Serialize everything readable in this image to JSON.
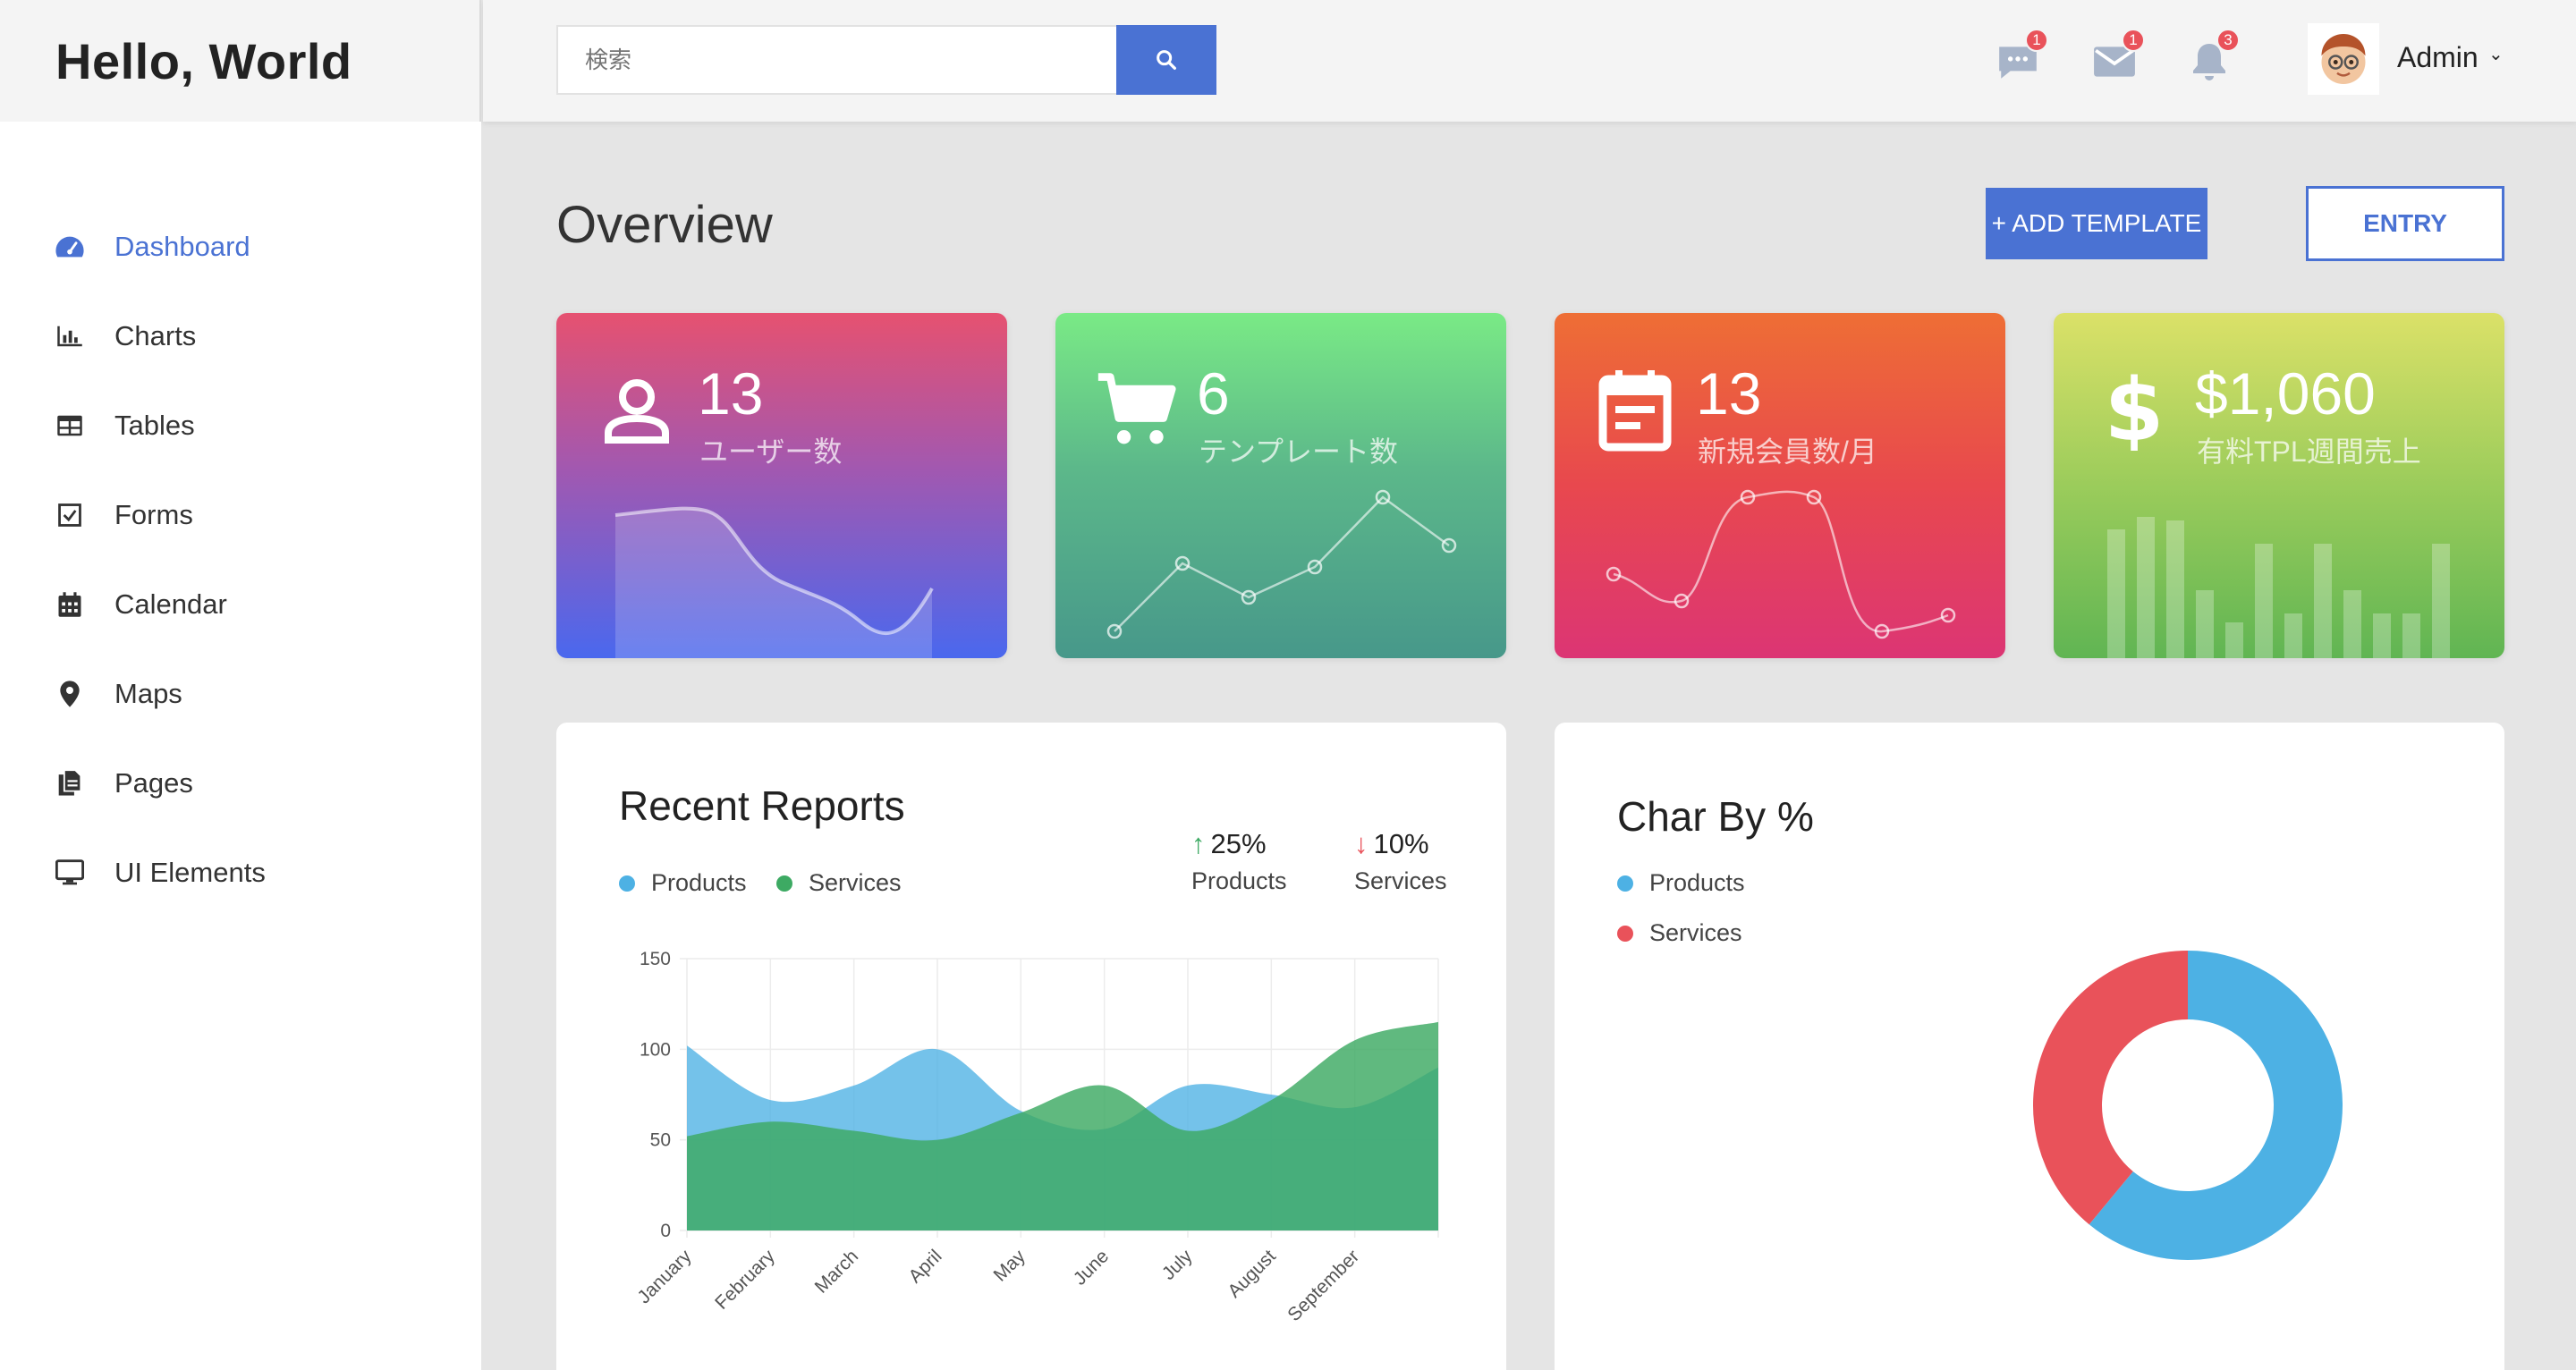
{
  "app": {
    "title": "Hello, World"
  },
  "search": {
    "placeholder": "検索"
  },
  "topbar": {
    "messages_badge": "1",
    "mail_badge": "1",
    "notifications_badge": "3",
    "user_name": "Admin"
  },
  "sidebar": {
    "items": [
      {
        "label": "Dashboard",
        "icon": "dashboard-icon",
        "active": true
      },
      {
        "label": "Charts",
        "icon": "bar-chart-icon"
      },
      {
        "label": "Tables",
        "icon": "table-icon"
      },
      {
        "label": "Forms",
        "icon": "checkbox-icon"
      },
      {
        "label": "Calendar",
        "icon": "calendar-icon"
      },
      {
        "label": "Maps",
        "icon": "map-pin-icon"
      },
      {
        "label": "Pages",
        "icon": "pages-icon"
      },
      {
        "label": "UI Elements",
        "icon": "monitor-icon"
      }
    ]
  },
  "main": {
    "title": "Overview",
    "add_button": "+ ADD TEMPLATE",
    "entry_button": "ENTRY"
  },
  "stats": [
    {
      "value": "13",
      "label": "ユーザー数",
      "icon": "user-icon"
    },
    {
      "value": "6",
      "label": "テンプレート数",
      "icon": "cart-icon"
    },
    {
      "value": "13",
      "label": "新規会員数/月",
      "icon": "calendar-note-icon"
    },
    {
      "value": "$1,060",
      "label": "有料TPL週間売上",
      "icon": "dollar-icon"
    }
  ],
  "reports": {
    "title": "Recent Reports",
    "legend": [
      "Products",
      "Services"
    ],
    "kpi_up": {
      "value": "25%",
      "label": "Products"
    },
    "kpi_down": {
      "value": "10%",
      "label": "Services"
    }
  },
  "percent": {
    "title": "Char By %",
    "legend": [
      "Products",
      "Services"
    ]
  },
  "colors": {
    "accent": "#4a72d3",
    "products": "#4db1e4",
    "services": "#3daa63",
    "services_donut": "#e9525a",
    "badge": "#e9525a"
  },
  "chart_data": [
    {
      "type": "area",
      "categories": [
        "January",
        "February",
        "March",
        "April",
        "May",
        "June",
        "July",
        "August",
        "September"
      ],
      "yticks": [
        "0",
        "50",
        "100",
        "150"
      ],
      "ylim": [
        0,
        150
      ],
      "series": [
        {
          "name": "Products",
          "values": [
            102,
            72,
            80,
            100,
            66,
            56,
            80,
            75,
            68,
            90
          ]
        },
        {
          "name": "Services",
          "values": [
            52,
            60,
            55,
            50,
            65,
            80,
            55,
            72,
            105,
            115
          ]
        }
      ],
      "grid": true,
      "legend": "top-left"
    },
    {
      "type": "pie",
      "categories": [
        "Products",
        "Services"
      ],
      "values": [
        61,
        39
      ],
      "legend": "top-left"
    }
  ]
}
